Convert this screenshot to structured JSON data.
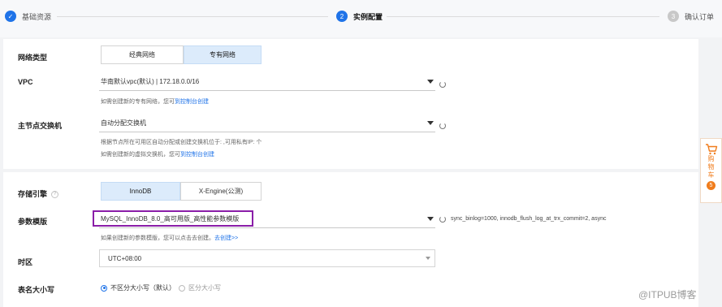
{
  "steps": {
    "step1": {
      "number": "✓",
      "label": "基础资源"
    },
    "step2": {
      "number": "2",
      "label": "实例配置"
    },
    "step3": {
      "number": "3",
      "label": "确认订单"
    }
  },
  "network": {
    "label": "网络类型",
    "options": [
      "经典网络",
      "专有网络"
    ],
    "selected": "专有网络"
  },
  "vpc": {
    "label": "VPC",
    "value": "华南默认vpc(默认) | 172.18.0.0/16",
    "hint_prefix": "如需创建新的专有网络，您可",
    "hint_link": "到控制台创建"
  },
  "vswitch": {
    "label": "主节点交换机",
    "value": "自动分配交换机",
    "hint1": "根据节点所在可用区自动分配或创建交换机位于: ,可用私有IP: 个",
    "hint2_prefix": "如需创建新的虚拟交换机，您可",
    "hint2_link": "到控制台创建"
  },
  "engine": {
    "label": "存储引擎",
    "help": "?",
    "options": [
      "InnoDB",
      "X-Engine(公测)"
    ],
    "selected": "InnoDB"
  },
  "param_template": {
    "label": "参数模版",
    "value": "MySQL_InnoDB_8.0_高可用版_高性能参数模版",
    "params": "sync_binlog=1000, innodb_flush_log_at_trx_commit=2, async",
    "hint_prefix": "如果创建新的参数模版，您可以点击去创建。",
    "hint_link": "去创建>>"
  },
  "timezone": {
    "label": "时区",
    "value": "UTC+08:00"
  },
  "table_case": {
    "label": "表名大小写",
    "options": [
      "不区分大小写（默认）",
      "区分大小写"
    ],
    "selected": "不区分大小写（默认）"
  },
  "cart": {
    "label": "购物车",
    "c1": "购",
    "c2": "物",
    "c3": "车",
    "count": "5"
  },
  "watermark": "@ITPUB博客",
  "colors": {
    "accent": "#1f73e8",
    "highlight_box": "#8a1ea8",
    "cart": "#f07c1c"
  }
}
